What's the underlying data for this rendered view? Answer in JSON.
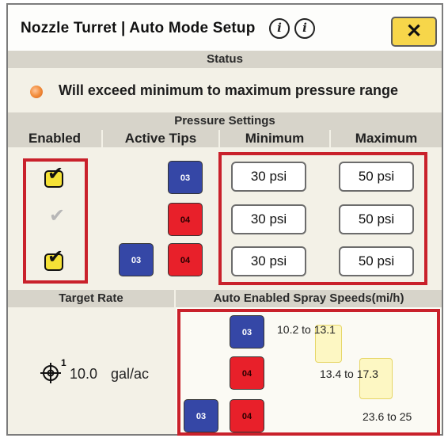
{
  "header": {
    "title": "Nozzle Turret | Auto Mode Setup",
    "info_icon_1": "i",
    "info_icon_2": "i",
    "close_label": "✕"
  },
  "status": {
    "header": "Status",
    "message": "Will exceed minimum to maximum pressure range",
    "indicator_color": "#f28d3c"
  },
  "pressure_settings": {
    "header": "Pressure Settings",
    "columns": [
      "Enabled",
      "Active Tips",
      "Minimum",
      "Maximum"
    ],
    "rows": [
      {
        "enabled": true,
        "tips": [
          "03"
        ],
        "minimum": "30 psi",
        "maximum": "50 psi"
      },
      {
        "enabled": false,
        "tips": [
          "04"
        ],
        "minimum": "30 psi",
        "maximum": "50 psi"
      },
      {
        "enabled": true,
        "tips": [
          "03",
          "04"
        ],
        "minimum": "30 psi",
        "maximum": "50 psi"
      }
    ]
  },
  "target_rate": {
    "header": "Target Rate",
    "superscript": "1",
    "value": "10.0",
    "unit": "gal/ac"
  },
  "spray_speeds": {
    "header": "Auto Enabled Spray Speeds(mi/h)",
    "rows": [
      {
        "tips": [
          "03"
        ],
        "range_text": "10.2 to 13.1"
      },
      {
        "tips": [
          "04"
        ],
        "range_text": "13.4 to 17.3"
      },
      {
        "tips": [
          "03",
          "04"
        ],
        "range_text": "23.6 to 25"
      }
    ]
  },
  "colors": {
    "tip_03": "#3547a6",
    "tip_04": "#e8202a",
    "highlight_red": "#c9212b",
    "checkbox_yellow": "#f5e237",
    "close_button_yellow": "#f7d64a"
  }
}
